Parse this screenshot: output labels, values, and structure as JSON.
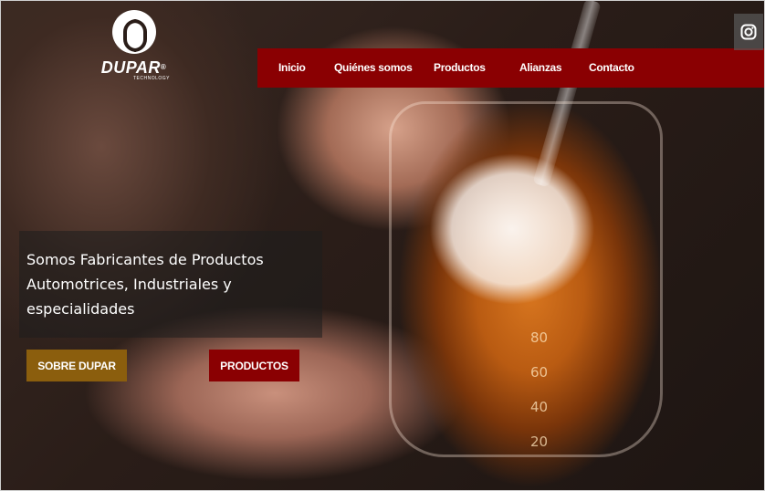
{
  "logo": {
    "name": "DUPAR",
    "registered": "®",
    "tagline": "TECHNOLOGY"
  },
  "nav": {
    "items": [
      {
        "label": "Inicio"
      },
      {
        "label": "Quiénes somos"
      },
      {
        "label": "Productos"
      },
      {
        "label": "Alianzas"
      },
      {
        "label": "Contacto"
      }
    ]
  },
  "social": {
    "icon": "instagram-icon"
  },
  "hero": {
    "title": "Somos Fabricantes de Productos Automotrices, Industriales y especialidades",
    "buttons": {
      "sobre": "SOBRE DUPAR",
      "productos": "PRODUCTOS"
    },
    "beaker_scale": [
      "80",
      "60",
      "40",
      "20"
    ]
  },
  "colors": {
    "nav_bg": "#8a0002",
    "sobre_button": "#8b5e0d",
    "productos_button": "#8a0002"
  }
}
